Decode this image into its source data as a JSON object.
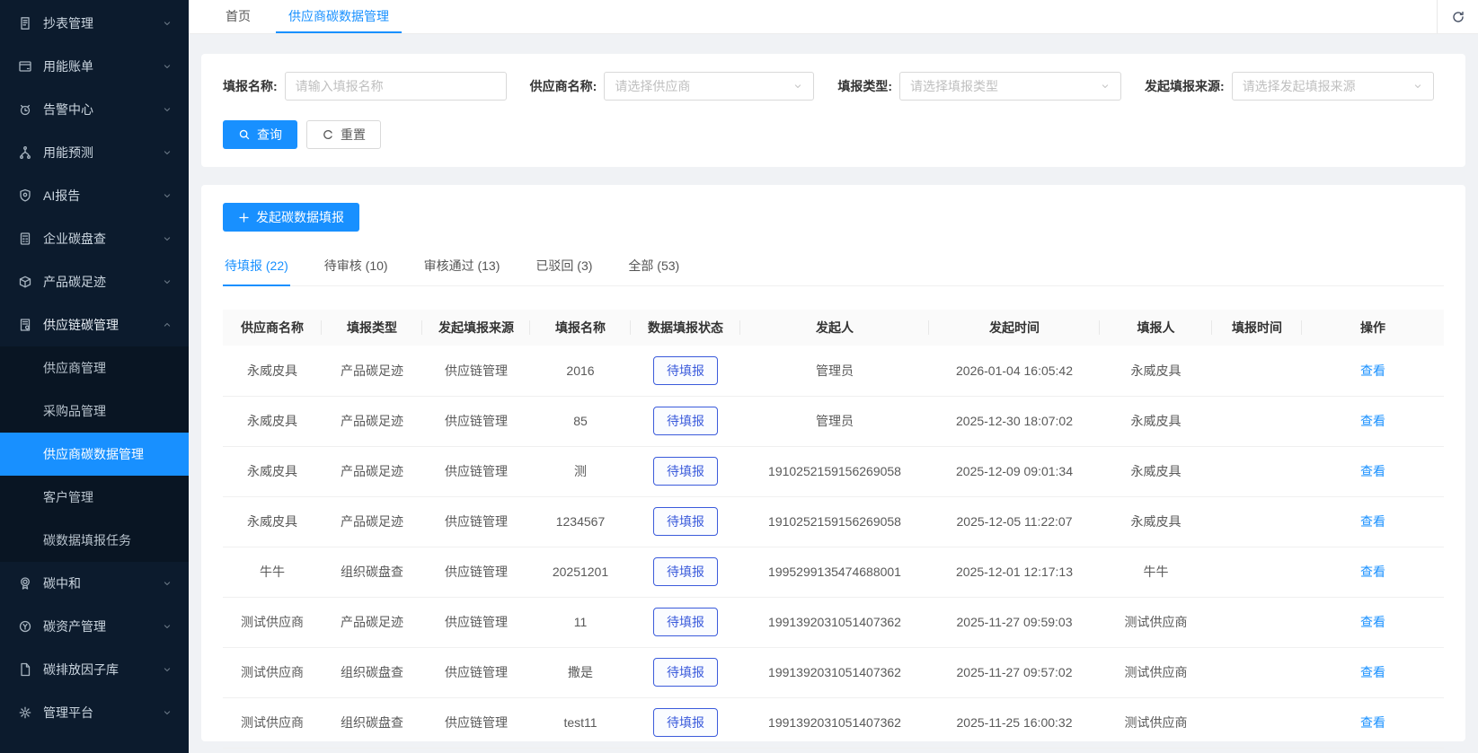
{
  "colors": {
    "sidebar_bg": "#0c1b2d",
    "submenu_bg": "#091523",
    "accent_blue": "#1890ff",
    "status_button_blue": "#3b5bdb",
    "content_bg": "#f0f2f5"
  },
  "sidebar": {
    "items": [
      {
        "label": "抄表管理",
        "icon": "meter-icon"
      },
      {
        "label": "用能账单",
        "icon": "bill-icon"
      },
      {
        "label": "告警中心",
        "icon": "alert-icon"
      },
      {
        "label": "用能预测",
        "icon": "forecast-icon"
      },
      {
        "label": "AI报告",
        "icon": "ai-report-icon"
      },
      {
        "label": "企业碳盘查",
        "icon": "enterprise-carbon-icon"
      },
      {
        "label": "产品碳足迹",
        "icon": "product-footprint-icon"
      },
      {
        "label": "供应链碳管理",
        "icon": "supply-chain-icon",
        "expanded": true,
        "children": [
          {
            "label": "供应商管理"
          },
          {
            "label": "采购品管理"
          },
          {
            "label": "供应商碳数据管理",
            "active": true
          },
          {
            "label": "客户管理"
          },
          {
            "label": "碳数据填报任务"
          }
        ]
      },
      {
        "label": "碳中和",
        "icon": "carbon-neutral-icon"
      },
      {
        "label": "碳资产管理",
        "icon": "carbon-asset-icon"
      },
      {
        "label": "碳排放因子库",
        "icon": "factor-library-icon"
      },
      {
        "label": "管理平台",
        "icon": "platform-icon"
      }
    ]
  },
  "tabbar": {
    "tabs": [
      {
        "label": "首页"
      },
      {
        "label": "供应商碳数据管理",
        "active": true
      }
    ],
    "refresh_icon": "refresh-icon"
  },
  "filters": {
    "name_label": "填报名称:",
    "name_placeholder": "请输入填报名称",
    "supplier_label": "供应商名称:",
    "supplier_placeholder": "请选择供应商",
    "type_label": "填报类型:",
    "type_placeholder": "请选择填报类型",
    "source_label": "发起填报来源:",
    "source_placeholder": "请选择发起填报来源",
    "search_label": "查询",
    "reset_label": "重置"
  },
  "main": {
    "create_button_label": "发起碳数据填报",
    "status_tabs": [
      {
        "label": "待填报 (22)",
        "active": true
      },
      {
        "label": "待审核 (10)"
      },
      {
        "label": "审核通过 (13)"
      },
      {
        "label": "已驳回 (3)"
      },
      {
        "label": "全部 (53)"
      }
    ],
    "table": {
      "columns": [
        "供应商名称",
        "填报类型",
        "发起填报来源",
        "填报名称",
        "数据填报状态",
        "发起人",
        "发起时间",
        "填报人",
        "填报时间",
        "操作"
      ],
      "rows": [
        {
          "supplier": "永威皮具",
          "type": "产品碳足迹",
          "source": "供应链管理",
          "name": "2016",
          "status": "待填报",
          "initiator": "管理员",
          "init_time": "2026-01-04 16:05:42",
          "filler": "永威皮具",
          "fill_time": "",
          "action": "查看"
        },
        {
          "supplier": "永威皮具",
          "type": "产品碳足迹",
          "source": "供应链管理",
          "name": "85",
          "status": "待填报",
          "initiator": "管理员",
          "init_time": "2025-12-30 18:07:02",
          "filler": "永威皮具",
          "fill_time": "",
          "action": "查看"
        },
        {
          "supplier": "永威皮具",
          "type": "产品碳足迹",
          "source": "供应链管理",
          "name": "测",
          "status": "待填报",
          "initiator": "1910252159156269058",
          "init_time": "2025-12-09 09:01:34",
          "filler": "永威皮具",
          "fill_time": "",
          "action": "查看"
        },
        {
          "supplier": "永威皮具",
          "type": "产品碳足迹",
          "source": "供应链管理",
          "name": "1234567",
          "status": "待填报",
          "initiator": "1910252159156269058",
          "init_time": "2025-12-05 11:22:07",
          "filler": "永威皮具",
          "fill_time": "",
          "action": "查看"
        },
        {
          "supplier": "牛牛",
          "type": "组织碳盘查",
          "source": "供应链管理",
          "name": "20251201",
          "status": "待填报",
          "initiator": "1995299135474688001",
          "init_time": "2025-12-01 12:17:13",
          "filler": "牛牛",
          "fill_time": "",
          "action": "查看"
        },
        {
          "supplier": "测试供应商",
          "type": "产品碳足迹",
          "source": "供应链管理",
          "name": "11",
          "status": "待填报",
          "initiator": "1991392031051407362",
          "init_time": "2025-11-27 09:59:03",
          "filler": "测试供应商",
          "fill_time": "",
          "action": "查看"
        },
        {
          "supplier": "测试供应商",
          "type": "组织碳盘查",
          "source": "供应链管理",
          "name": "撒是",
          "status": "待填报",
          "initiator": "1991392031051407362",
          "init_time": "2025-11-27 09:57:02",
          "filler": "测试供应商",
          "fill_time": "",
          "action": "查看"
        },
        {
          "supplier": "测试供应商",
          "type": "组织碳盘查",
          "source": "供应链管理",
          "name": "test11",
          "status": "待填报",
          "initiator": "1991392031051407362",
          "init_time": "2025-11-25 16:00:32",
          "filler": "测试供应商",
          "fill_time": "",
          "action": "查看"
        }
      ]
    }
  }
}
